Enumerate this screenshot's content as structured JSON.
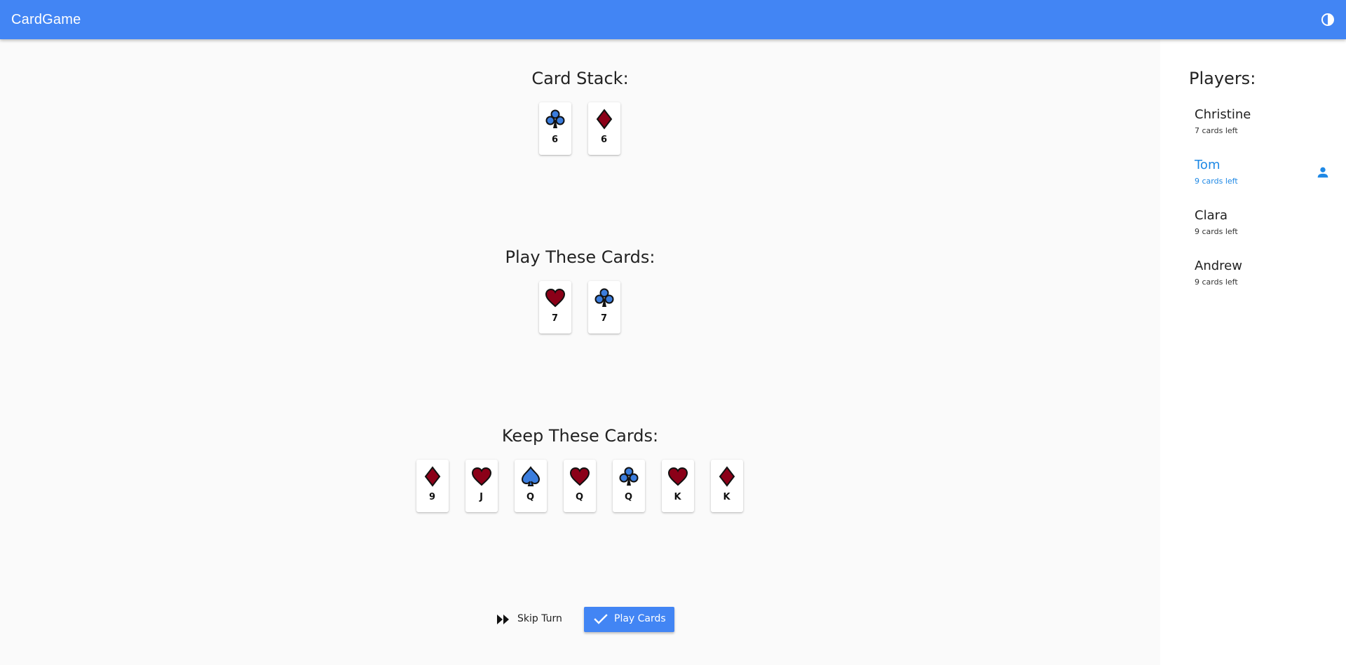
{
  "app": {
    "title": "CardGame"
  },
  "colors": {
    "toolbar": "#4285f4",
    "red_suit": "#8b0018",
    "blue_suit": "#3b7ddd",
    "active_player": "#1e88e5"
  },
  "icons": {
    "theme": "contrast-icon",
    "skip": "fast-forward-icon",
    "play": "check-icon",
    "current_player": "person-icon"
  },
  "card_stack": {
    "title": "Card Stack:",
    "cards": [
      {
        "suit": "clubs",
        "rank": "6"
      },
      {
        "suit": "diamonds",
        "rank": "6"
      }
    ]
  },
  "play_cards": {
    "title": "Play These Cards:",
    "cards": [
      {
        "suit": "hearts",
        "rank": "7"
      },
      {
        "suit": "clubs",
        "rank": "7"
      }
    ]
  },
  "keep_cards": {
    "title": "Keep These Cards:",
    "cards": [
      {
        "suit": "diamonds",
        "rank": "9"
      },
      {
        "suit": "hearts",
        "rank": "J"
      },
      {
        "suit": "spades",
        "rank": "Q"
      },
      {
        "suit": "hearts",
        "rank": "Q"
      },
      {
        "suit": "clubs",
        "rank": "Q"
      },
      {
        "suit": "hearts",
        "rank": "K"
      },
      {
        "suit": "diamonds",
        "rank": "K"
      }
    ]
  },
  "actions": {
    "skip_label": "Skip Turn",
    "play_label": "Play Cards"
  },
  "players": {
    "title": "Players:",
    "list": [
      {
        "name": "Christine",
        "cards_left": "7 cards left",
        "active": false
      },
      {
        "name": "Tom",
        "cards_left": "9 cards left",
        "active": true
      },
      {
        "name": "Clara",
        "cards_left": "9 cards left",
        "active": false
      },
      {
        "name": "Andrew",
        "cards_left": "9 cards left",
        "active": false
      }
    ]
  }
}
